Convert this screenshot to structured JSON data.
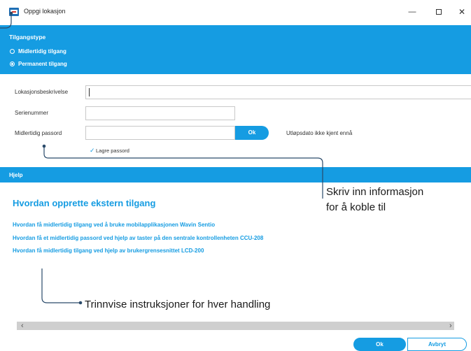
{
  "window": {
    "title": "Oppgi lokasjon",
    "minimize_glyph": "—",
    "close_glyph": "✕"
  },
  "access": {
    "heading": "Tilgangstype",
    "options": [
      {
        "label": "Midlertidig tilgang",
        "selected": false
      },
      {
        "label": "Permanent tilgang",
        "selected": true
      }
    ]
  },
  "form": {
    "description_label": "Lokasjonsbeskrivelse",
    "description_value": "",
    "serial_label": "Serienummer",
    "serial_value": "",
    "password_label": "Midlertidig passord",
    "password_value": "",
    "generate_label": "Ok",
    "update_status": "Utløpsdato ikke kjent ennå",
    "save_password_label": "Lagre passord",
    "save_password_checked": true,
    "check_glyph": "✓"
  },
  "help": {
    "title": "Hjelp",
    "heading": "Hvordan opprette ekstern tilgang",
    "links": [
      "Hvordan få midlertidig tilgang ved å bruke mobilapplikasjonen Wavin Sentio",
      "Hvordan få et midlertidig passord ved hjelp av taster på den sentrale kontrollenheten CCU-208",
      "Hvordan få midlertidig tilgang ved hjelp av brukergrensesnittet LCD-200"
    ]
  },
  "callouts": {
    "connect_line1": "Skriv inn informasjon",
    "connect_line2": "for å koble til",
    "steps": "Trinnvise instruksjoner for hver handling"
  },
  "scrollbar": {
    "left_arrow": "‹",
    "right_arrow": "›"
  },
  "footer": {
    "ok_label": "Ok",
    "cancel_label": "Avbryt"
  },
  "colors": {
    "accent": "#159ce2",
    "annotation": "#2a4a6a"
  }
}
